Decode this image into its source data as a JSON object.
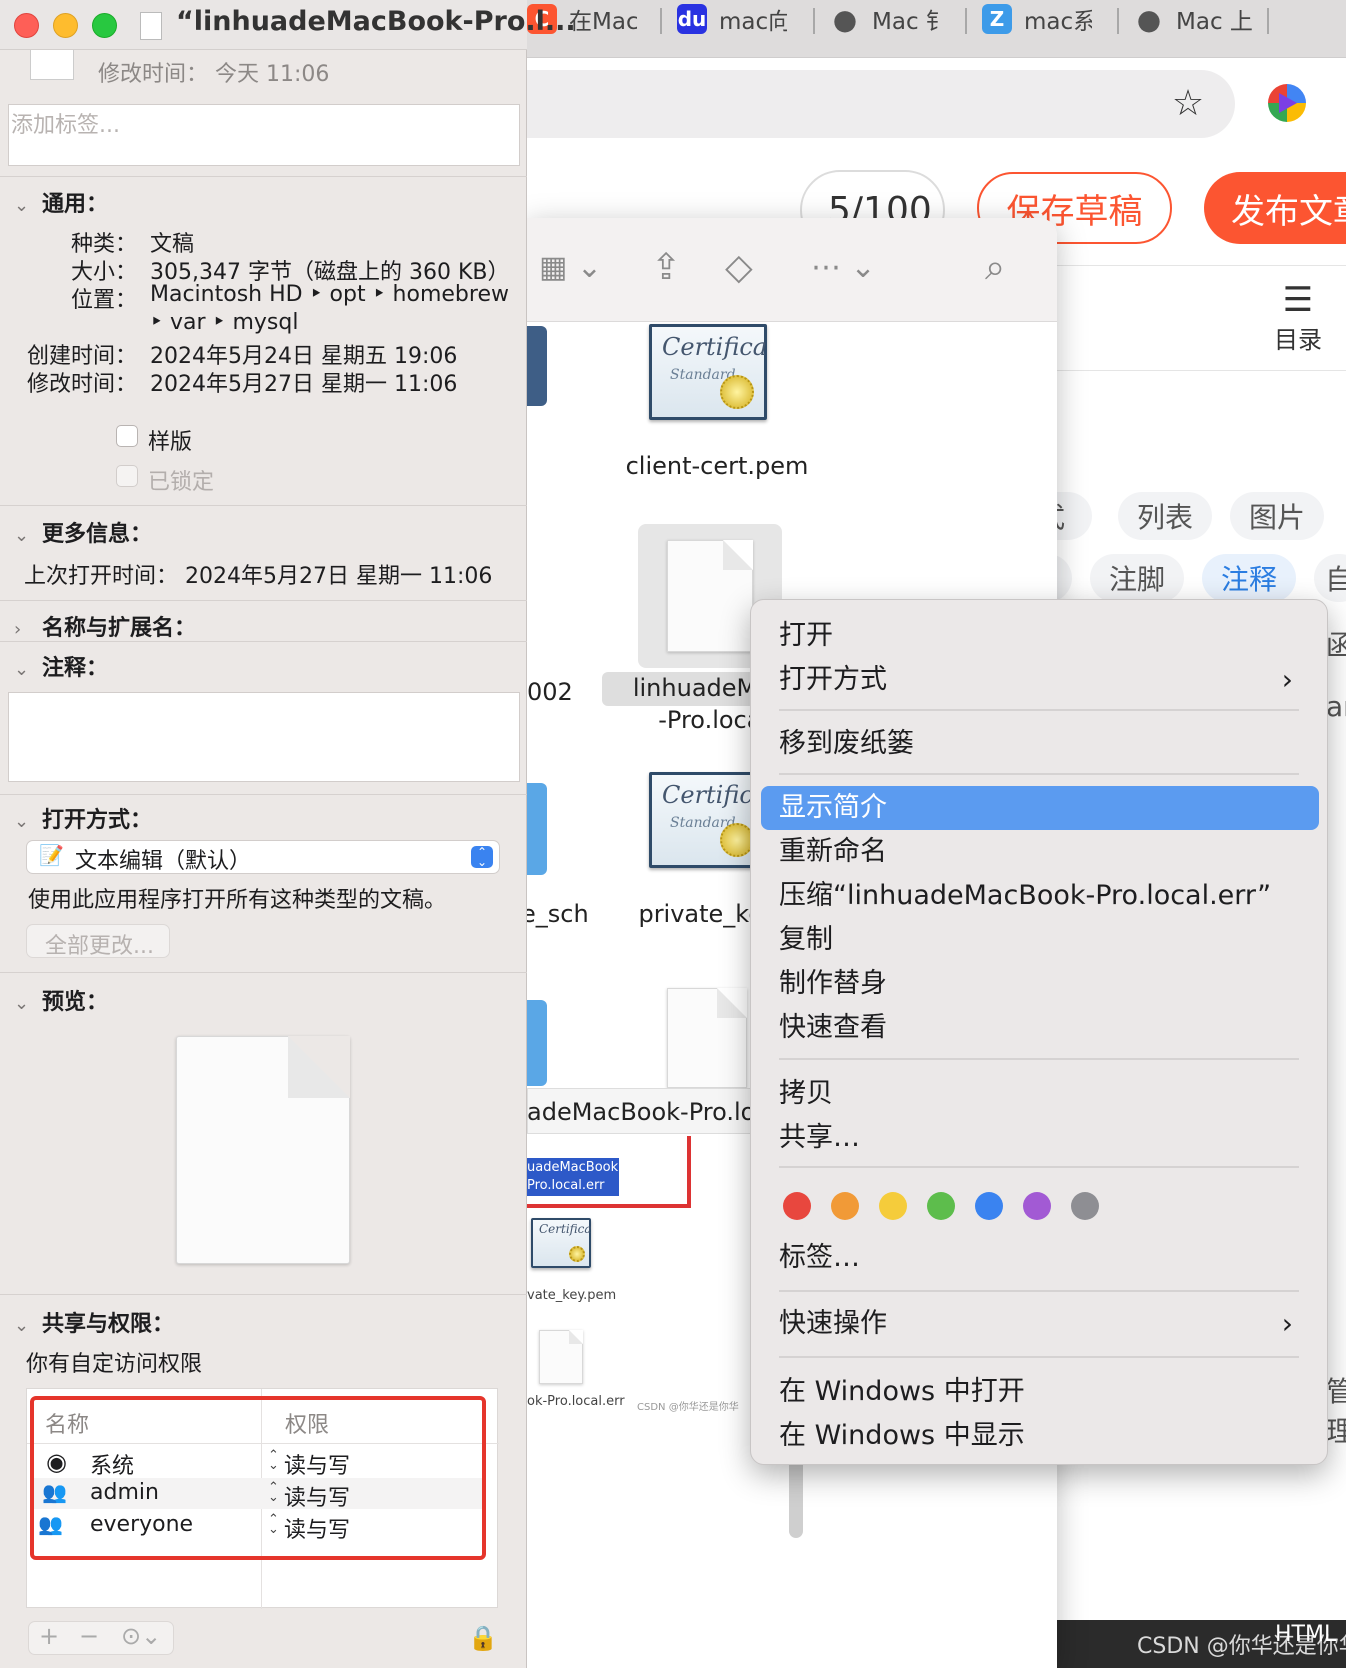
{
  "browser": {
    "tabs": [
      {
        "label": "在Mac",
        "icon": "csdn-favicon-icon",
        "color": "#fc5531"
      },
      {
        "label": "mac向",
        "icon": "baidu-favicon-icon",
        "color": "#2932e1"
      },
      {
        "label": "Mac 钅",
        "icon": "apple-favicon-icon"
      },
      {
        "label": "mac系",
        "icon": "doc-favicon-icon",
        "color": "#3d9be9"
      },
      {
        "label": "Mac 上",
        "icon": "apple-favicon-icon"
      }
    ],
    "editor": {
      "word_count": "5/100",
      "save_draft": "保存草稿",
      "publish": "发布文章",
      "toc_label": "目录",
      "chips_row1": [
        "式",
        "列表",
        "图片"
      ],
      "chips_row2": [
        "注脚",
        "注释",
        "自"
      ],
      "fragments": [
        "函",
        "ar",
        "管理"
      ]
    },
    "watermark": "CSDN @你华还是你华",
    "html_tag": "HTML"
  },
  "finder": {
    "files": [
      {
        "name": "client-cert.pem",
        "kind": "certificate"
      },
      {
        "name_line1": "linhuadeMac",
        "name_line2": "-Pro.local.",
        "kind": "document"
      },
      {
        "name": "private_key.",
        "kind": "certificate"
      },
      {
        "name": "002",
        "kind": "partial"
      },
      {
        "name": "e_sch",
        "kind": "partial"
      }
    ],
    "drag_label": "adeMacBook-Pro.loc",
    "mini_label1": "uadeMacBook",
    "mini_label2": "Pro.local.err",
    "mini_cert_label": "vate_key.pem",
    "mini_doc_label": "ok-Pro.local.err",
    "mini_watermark": "CSDN @你华还是你华"
  },
  "context_menu": {
    "items": [
      {
        "label": "打开"
      },
      {
        "label": "打开方式",
        "submenu": true
      },
      {
        "label": "移到废纸篓"
      },
      {
        "label": "显示简介",
        "highlighted": true
      },
      {
        "label": "重新命名"
      },
      {
        "label": "压缩“linhuadeMacBook-Pro.local.err”"
      },
      {
        "label": "复制"
      },
      {
        "label": "制作替身"
      },
      {
        "label": "快速查看"
      },
      {
        "label": "拷贝"
      },
      {
        "label": "共享…"
      },
      {
        "label": "标签…"
      },
      {
        "label": "快速操作",
        "submenu": true
      },
      {
        "label": "在 Windows 中打开"
      },
      {
        "label": "在 Windows 中显示"
      }
    ],
    "tag_colors": [
      "#e8473e",
      "#f19a37",
      "#f5cc3b",
      "#5dbd4c",
      "#3a83f0",
      "#a25ad4",
      "#8e8e93"
    ]
  },
  "info_panel": {
    "title": "“linhuadeMacBook-Pro.l...",
    "modified_top": "修改时间：  今天 11:06",
    "tags_placeholder": "添加标签...",
    "general": {
      "header": "通用：",
      "kind_label": "种类：",
      "kind": "文稿",
      "size_label": "大小：",
      "size": "305,347 字节（磁盘上的 360 KB）",
      "where_label": "位置：",
      "where_line1": "Macintosh HD ‣ opt ‣ homebrew",
      "where_line2": "‣ var ‣ mysql",
      "created_label": "创建时间：",
      "created": "2024年5月24日 星期五 19:06",
      "modified_label": "修改时间：",
      "modified": "2024年5月27日 星期一 11:06",
      "stationery": "样版",
      "locked": "已锁定"
    },
    "more_info": {
      "header": "更多信息：",
      "last_opened": "上次打开时间：  2024年5月27日 星期一 11:06"
    },
    "name_ext": {
      "header": "名称与扩展名："
    },
    "comments": {
      "header": "注释："
    },
    "open_with": {
      "header": "打开方式：",
      "app": "文本编辑（默认）",
      "description": "使用此应用程序打开所有这种类型的文稿。",
      "change_all": "全部更改..."
    },
    "preview": {
      "header": "预览："
    },
    "sharing": {
      "header": "共享与权限：",
      "summary": "你有自定访问权限",
      "col_name": "名称",
      "col_priv": "权限",
      "rows": [
        {
          "name": "系统",
          "icon": "user-icon",
          "priv": "读与写"
        },
        {
          "name": "admin",
          "icon": "group-icon",
          "priv": "读与写"
        },
        {
          "name": "everyone",
          "icon": "everyone-icon",
          "priv": "读与写"
        }
      ]
    }
  }
}
